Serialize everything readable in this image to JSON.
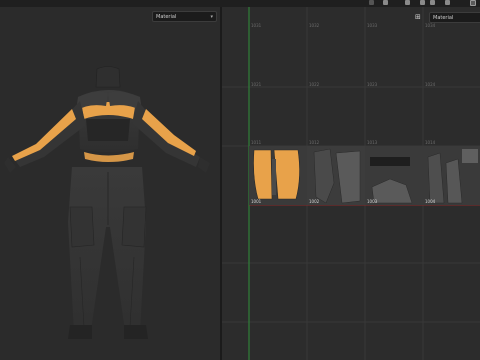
{
  "toolbar": {
    "icons": [
      "tool-icon-1",
      "tool-icon-2",
      "tool-icon-3",
      "tool-icon-4",
      "tool-icon-5",
      "tool-icon-6",
      "tool-icon-7"
    ]
  },
  "viewport": {
    "shading_mode": "Material",
    "accent_color": "#e8a24a",
    "garment_color": "#3a3a3a"
  },
  "uv_editor": {
    "shading_mode": "Material",
    "axis_colors": {
      "y_axis": "#2f8f3a",
      "x_axis": "#8a2a2a"
    },
    "tile_grid_labels": [
      "1031",
      "1032",
      "1033",
      "1034",
      "1021",
      "1022",
      "1023",
      "1024",
      "1011",
      "1012",
      "1013",
      "1014"
    ],
    "udim_tiles": [
      "1001",
      "1002",
      "1003",
      "1004"
    ]
  }
}
